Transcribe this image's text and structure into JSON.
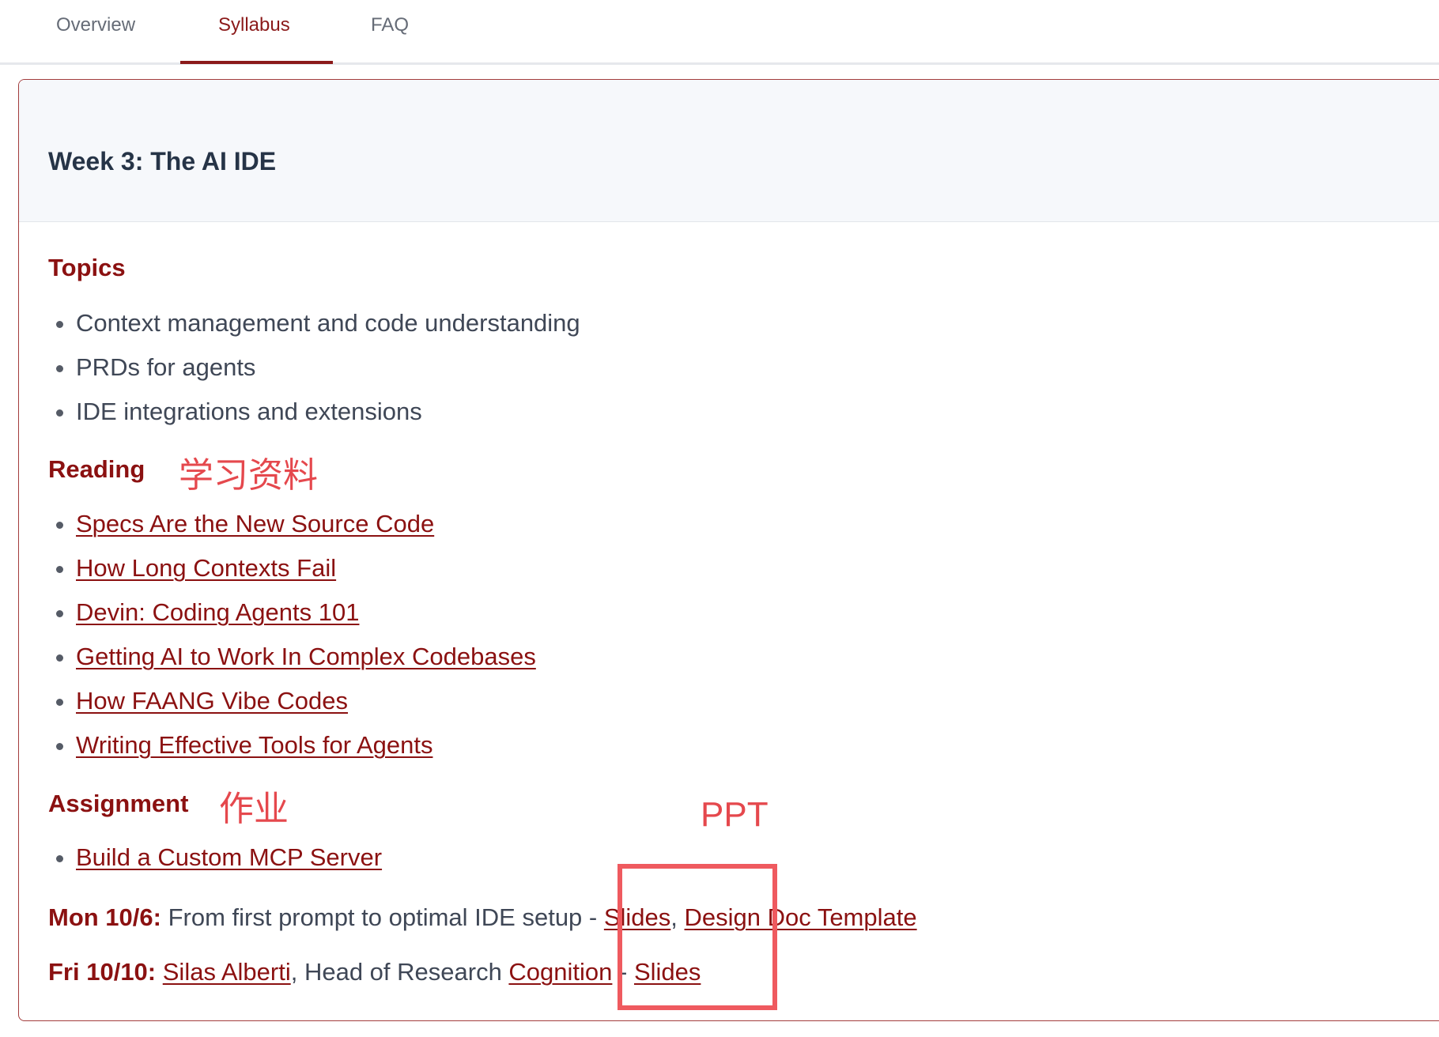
{
  "tabs": [
    {
      "label": "Overview",
      "active": false
    },
    {
      "label": "Syllabus",
      "active": true
    },
    {
      "label": "FAQ",
      "active": false
    }
  ],
  "week": {
    "title": "Week 3: The AI IDE"
  },
  "topics": {
    "heading": "Topics",
    "items": [
      "Context management and code understanding",
      "PRDs for agents",
      "IDE integrations and extensions"
    ]
  },
  "reading": {
    "heading": "Reading",
    "annotation": "学习资料",
    "items": [
      "Specs Are the New Source Code",
      "How Long Contexts Fail",
      "Devin: Coding Agents 101",
      "Getting AI to Work In Complex Codebases",
      "How FAANG Vibe Codes",
      "Writing Effective Tools for Agents"
    ]
  },
  "assignment": {
    "heading": "Assignment",
    "annotation": "作业",
    "items": [
      "Build a Custom MCP Server"
    ]
  },
  "annotation_ppt": "PPT",
  "schedule": {
    "mon": {
      "day": "Mon 10/6:",
      "text": " From first prompt to optimal IDE setup - ",
      "slides": "Slides",
      "sep": ", ",
      "template": "Design Doc Template"
    },
    "fri": {
      "day": "Fri 10/10:",
      "speaker": "Silas Alberti",
      "role": ", Head of Research ",
      "company": "Cognition",
      "dash": " - ",
      "slides": "Slides"
    }
  },
  "colors": {
    "accent": "#8b1111",
    "annotation": "#e5484d"
  }
}
